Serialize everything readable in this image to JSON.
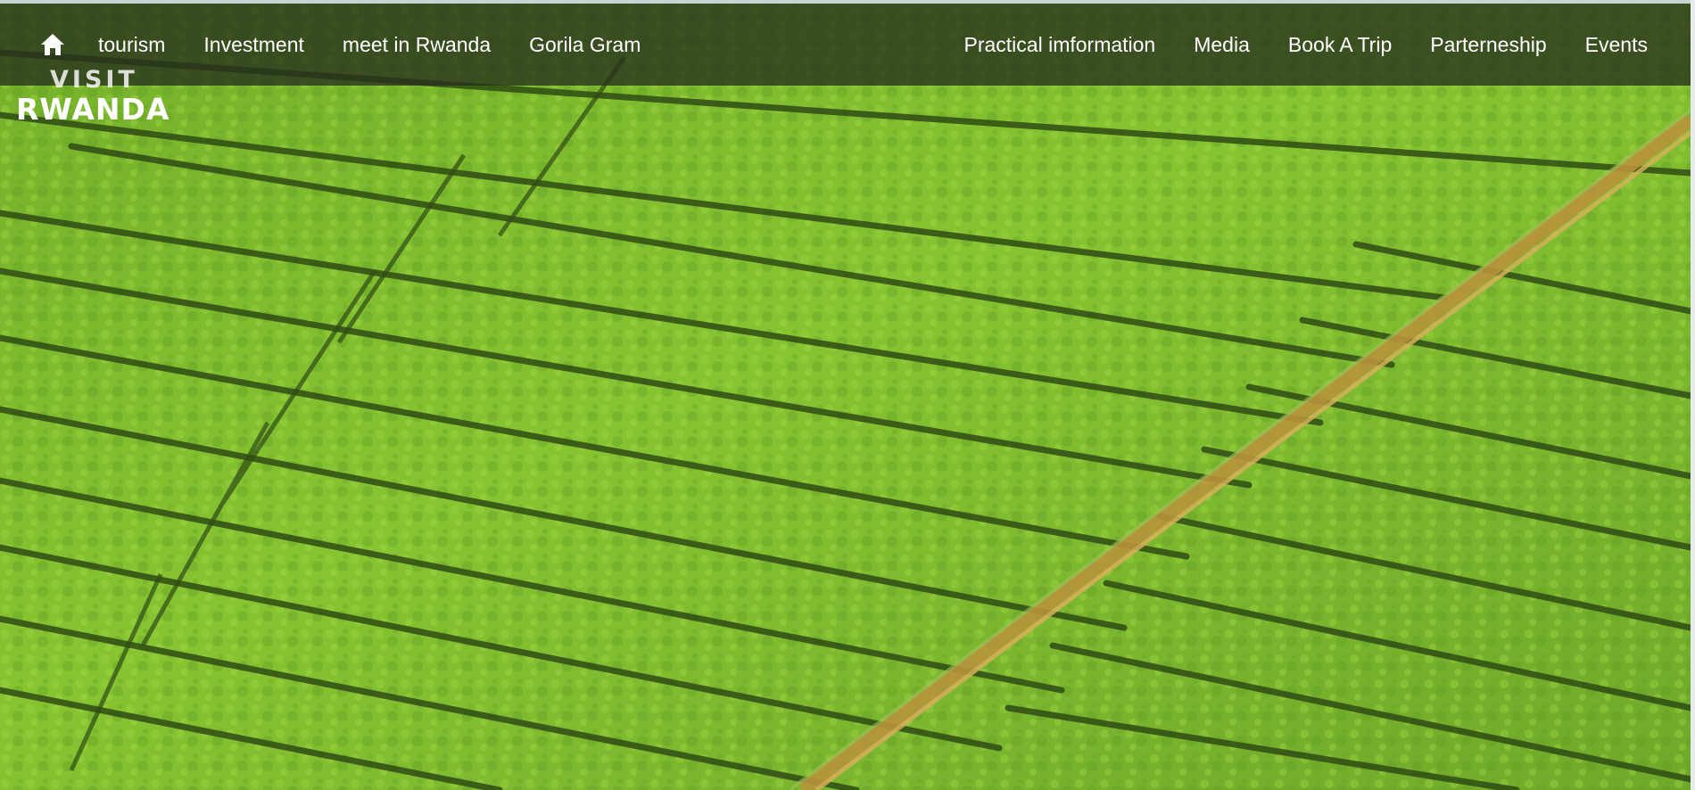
{
  "nav": {
    "home_icon": "home-icon",
    "left_items": [
      {
        "label": "tourism"
      },
      {
        "label": "Investment"
      },
      {
        "label": "meet in Rwanda"
      },
      {
        "label": "Gorila Gram"
      }
    ],
    "right_items": [
      {
        "label": "Practical imformation"
      },
      {
        "label": "Media"
      },
      {
        "label": "Book A Trip"
      },
      {
        "label": "Parterneship"
      },
      {
        "label": "Events"
      }
    ]
  },
  "logo": {
    "line1": "VISIT",
    "line2": "RWANDA"
  },
  "colors": {
    "nav_background": "#26301c",
    "field_green": "#7fbf2e",
    "row_shadow": "#2e4d12",
    "path": "#c99a3a"
  }
}
